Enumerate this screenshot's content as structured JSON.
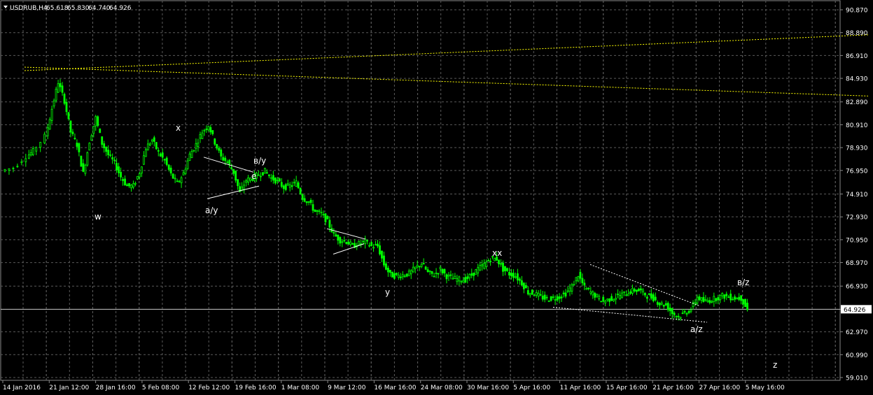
{
  "chart_data": {
    "type": "candlestick",
    "header": {
      "symbol": "USDRUB,H4",
      "open": "65.618",
      "high": "65.830",
      "low": "64.740",
      "close": "64.926"
    },
    "y_ticks": [
      "90.870",
      "88.890",
      "86.910",
      "84.930",
      "82.890",
      "80.910",
      "78.930",
      "76.950",
      "74.910",
      "72.930",
      "70.950",
      "68.970",
      "66.930",
      "64.926",
      "62.970",
      "60.990",
      "59.010"
    ],
    "ylim": [
      59.01,
      90.87
    ],
    "current_price": 64.926,
    "x_ticks": [
      "14 Jan 2016",
      "21 Jan 12:00",
      "28 Jan 16:00",
      "5 Feb 08:00",
      "12 Feb 12:00",
      "19 Feb 16:00",
      "1 Mar 08:00",
      "9 Mar 12:00",
      "16 Mar 16:00",
      "24 Mar 08:00",
      "30 Mar 16:00",
      "5 Apr 16:00",
      "11 Apr 16:00",
      "15 Apr 16:00",
      "21 Apr 16:00",
      "27 Apr 16:00",
      "5 May 16:00"
    ],
    "price_path": [
      [
        0,
        76.9
      ],
      [
        2,
        77.2
      ],
      [
        4,
        78.2
      ],
      [
        5,
        78.6
      ],
      [
        7,
        79.9
      ],
      [
        8,
        82.3
      ],
      [
        9,
        84.6
      ],
      [
        10,
        83.0
      ],
      [
        11,
        80.3
      ],
      [
        12,
        79.2
      ],
      [
        13,
        76.7
      ],
      [
        14,
        79.5
      ],
      [
        15,
        81.5
      ],
      [
        16,
        79.3
      ],
      [
        17,
        78.3
      ],
      [
        18,
        77.6
      ],
      [
        19,
        76.4
      ],
      [
        20,
        75.6
      ],
      [
        21,
        75.6
      ],
      [
        22,
        76.8
      ],
      [
        23,
        78.9
      ],
      [
        24,
        79.6
      ],
      [
        25,
        78.5
      ],
      [
        26,
        77.8
      ],
      [
        27,
        76.6
      ],
      [
        28,
        75.8
      ],
      [
        29,
        76.7
      ],
      [
        30,
        78.3
      ],
      [
        31,
        79.2
      ],
      [
        32,
        80.3
      ],
      [
        33,
        80.9
      ],
      [
        34,
        79.4
      ],
      [
        35,
        78.1
      ],
      [
        36,
        77.7
      ],
      [
        37,
        76.8
      ],
      [
        38,
        75.0
      ],
      [
        39,
        76.1
      ],
      [
        40,
        76.3
      ],
      [
        41,
        76.6
      ],
      [
        42,
        76.9
      ],
      [
        43,
        76.3
      ],
      [
        44,
        76.0
      ],
      [
        45,
        75.5
      ],
      [
        46,
        75.6
      ],
      [
        47,
        75.9
      ],
      [
        48,
        74.6
      ],
      [
        49,
        74.2
      ],
      [
        50,
        73.4
      ],
      [
        51,
        73.2
      ],
      [
        52,
        72.5
      ],
      [
        53,
        71.4
      ],
      [
        54,
        70.9
      ],
      [
        55,
        70.8
      ],
      [
        56,
        70.4
      ],
      [
        57,
        70.6
      ],
      [
        58,
        70.8
      ],
      [
        59,
        70.4
      ],
      [
        60,
        70.4
      ],
      [
        61,
        68.8
      ],
      [
        62,
        67.9
      ],
      [
        63,
        67.8
      ],
      [
        64,
        67.9
      ],
      [
        65,
        68.0
      ],
      [
        66,
        68.5
      ],
      [
        67,
        68.9
      ],
      [
        68,
        68.1
      ],
      [
        69,
        67.9
      ],
      [
        70,
        68.4
      ],
      [
        71,
        67.8
      ],
      [
        72,
        67.6
      ],
      [
        73,
        67.5
      ],
      [
        74,
        67.5
      ],
      [
        75,
        67.9
      ],
      [
        76,
        68.4
      ],
      [
        77,
        68.8
      ],
      [
        78,
        69.3
      ],
      [
        79,
        69.3
      ],
      [
        80,
        68.4
      ],
      [
        81,
        68.0
      ],
      [
        82,
        67.8
      ],
      [
        83,
        67.2
      ],
      [
        84,
        66.4
      ],
      [
        85,
        66.3
      ],
      [
        86,
        66.0
      ],
      [
        87,
        65.8
      ],
      [
        88,
        65.9
      ],
      [
        89,
        66.0
      ],
      [
        90,
        66.3
      ],
      [
        91,
        66.9
      ],
      [
        92,
        67.9
      ],
      [
        93,
        66.8
      ],
      [
        94,
        66.4
      ],
      [
        95,
        66.0
      ],
      [
        96,
        65.6
      ],
      [
        97,
        65.8
      ],
      [
        98,
        66.0
      ],
      [
        99,
        66.2
      ],
      [
        100,
        66.4
      ],
      [
        101,
        66.6
      ],
      [
        102,
        66.5
      ],
      [
        103,
        66.1
      ],
      [
        104,
        65.9
      ],
      [
        105,
        65.4
      ],
      [
        106,
        65.3
      ],
      [
        107,
        64.6
      ],
      [
        108,
        64.3
      ],
      [
        109,
        64.6
      ],
      [
        110,
        64.9
      ],
      [
        111,
        66.0
      ],
      [
        112,
        65.6
      ],
      [
        113,
        65.7
      ],
      [
        114,
        65.9
      ],
      [
        115,
        66.1
      ],
      [
        116,
        66.0
      ],
      [
        117,
        65.9
      ],
      [
        118,
        65.9
      ],
      [
        119,
        64.9
      ]
    ],
    "wave_labels": [
      "x",
      "в/у",
      "e",
      "a/у",
      "w",
      "xx",
      "y",
      "в/z",
      "a/z",
      "z"
    ],
    "grid": "dashed",
    "colors": {
      "background": "#000000",
      "candle": "#00ff00",
      "grid": "#5a5a5a",
      "text": "#ffffff",
      "trend_line": "#ffff00"
    }
  }
}
